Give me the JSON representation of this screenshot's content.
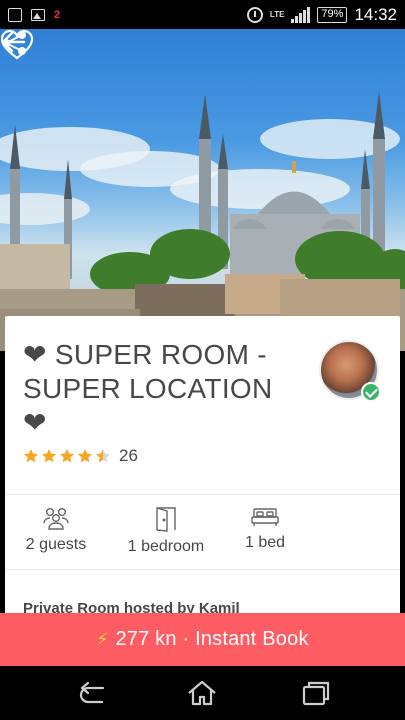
{
  "status_bar": {
    "notification_count": "2",
    "network": "LTE",
    "battery": "79%",
    "time": "14:32"
  },
  "header": {
    "back_icon": "arrow-left-icon",
    "share_icon": "share-icon",
    "favorite_icon": "heart-outline-icon"
  },
  "listing": {
    "title": "❤ SUPER ROOM - SUPER LOCATION ❤",
    "rating": 4.5,
    "review_count": "26",
    "host_line": "Private Room hosted by Kamil",
    "amenities": [
      {
        "icon": "guests-icon",
        "label": "2 guests"
      },
      {
        "icon": "door-icon",
        "label": "1 bedroom"
      },
      {
        "icon": "bed-icon",
        "label": "1 bed"
      }
    ]
  },
  "booking": {
    "label": "277 kn · Instant Book",
    "bolt_icon": "lightning-icon"
  },
  "colors": {
    "accent": "#fd5c63",
    "star": "#f5a623",
    "verified": "#3fb36b"
  }
}
